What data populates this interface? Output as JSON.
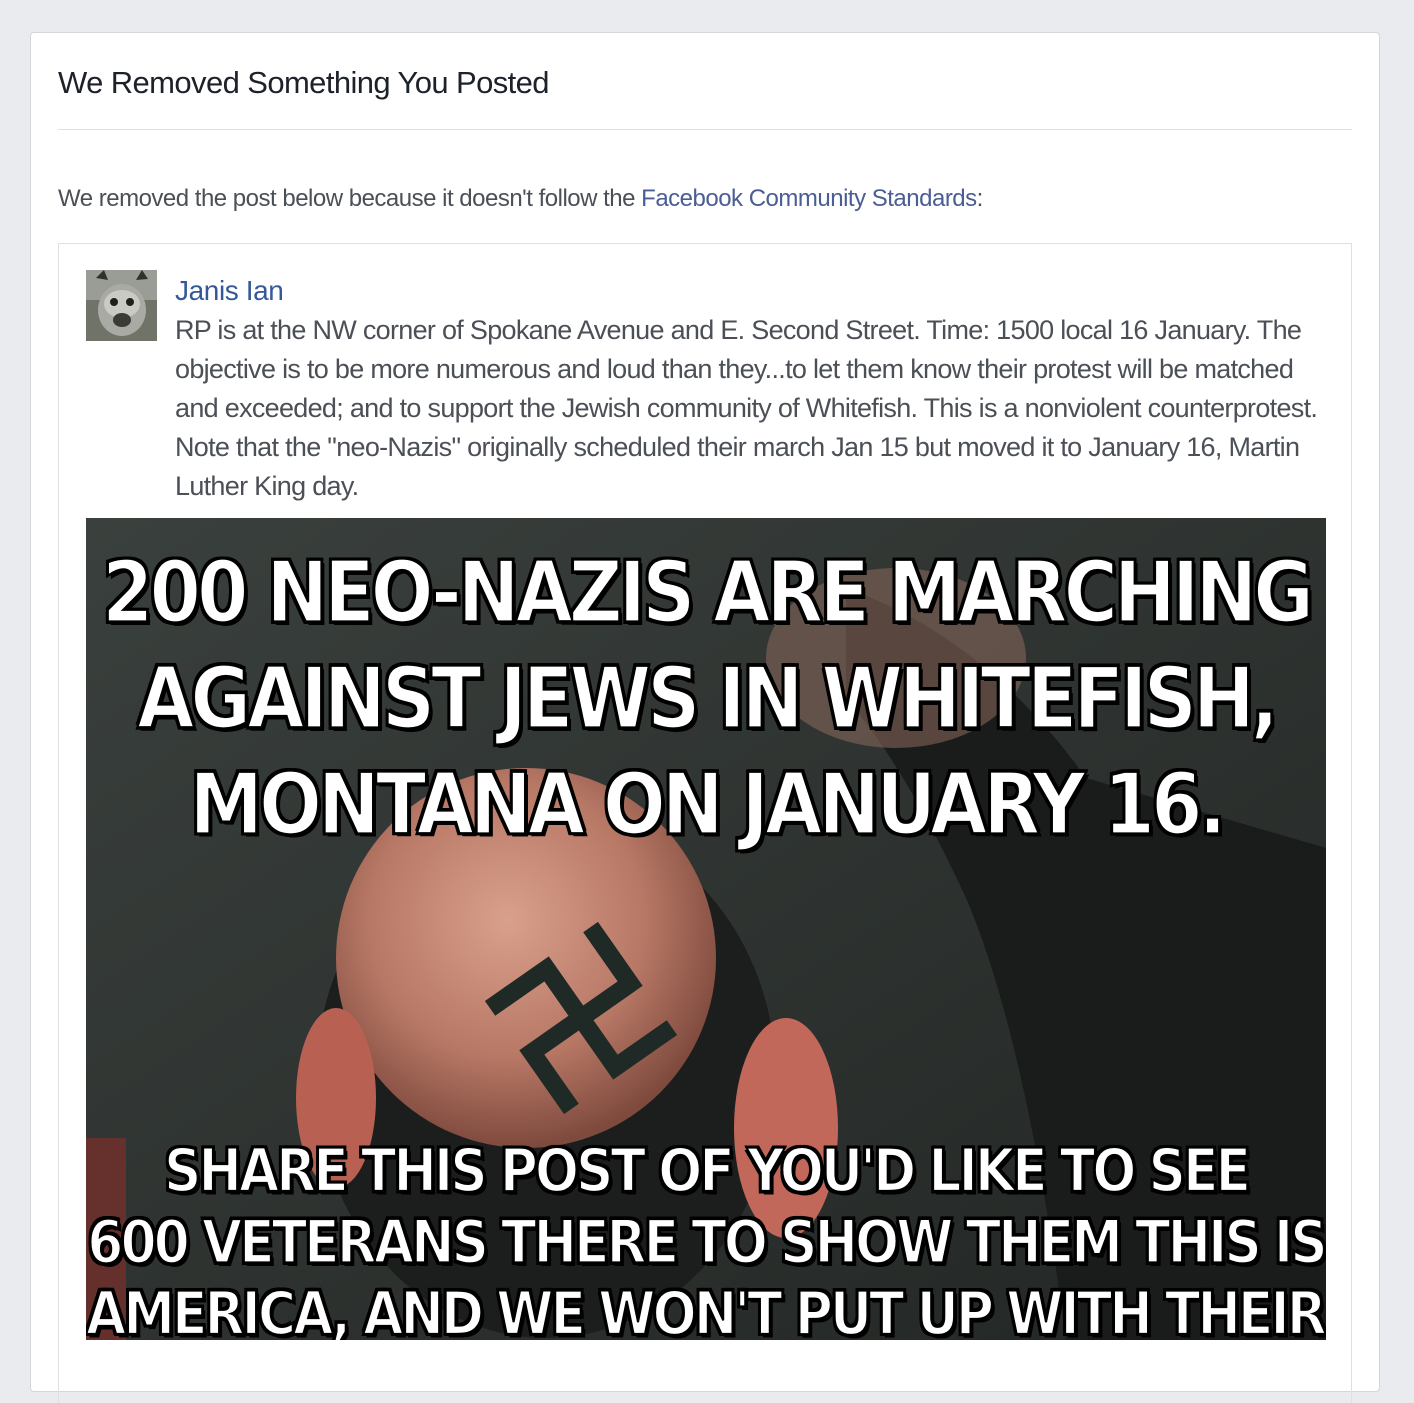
{
  "dialog": {
    "title": "We Removed Something You Posted",
    "notice_prefix": "We removed the post below because it doesn't follow the ",
    "notice_link": "Facebook Community Standards",
    "notice_suffix": ":"
  },
  "post": {
    "author": "Janis Ian",
    "text": "RP is at the NW corner of Spokane Avenue and E. Second Street. Time: 1500 local 16 January. The objective is to be more numerous and loud than they...to let them know their protest will be matched and exceeded; and to support the Jewish community of Whitefish. This is a nonviolent counterprotest. Note that the \"neo-Nazis\" originally scheduled their march Jan 15 but moved it to January 16, Martin Luther King day.",
    "image": {
      "top_lines": [
        "200 NEO-NAZIS ARE MARCHING",
        "AGAINST JEWS IN WHITEFISH,",
        "MONTANA ON JANUARY 16."
      ],
      "bottom_lines": [
        "SHARE THIS POST OF YOU'D LIKE TO SEE",
        "600 VETERANS THERE TO SHOW THEM THIS IS",
        "AMERICA, AND WE WON'T PUT UP WITH THEIR CRAP."
      ]
    }
  },
  "colors": {
    "background": "#e9ebee",
    "link": "#4a5d94",
    "author": "#365899",
    "text": "#4b4f56"
  }
}
